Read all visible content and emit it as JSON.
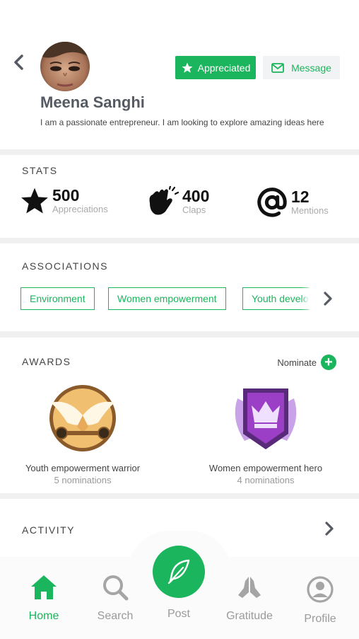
{
  "colors": {
    "accent": "#1ab55c",
    "background": "#f0f0f0"
  },
  "profile": {
    "name": "Meena Sanghi",
    "bio": "I am a passionate entrepreneur. I am looking to explore amazing ideas here",
    "appreciated_label": "Appreciated",
    "message_label": "Message"
  },
  "stats": {
    "title": "STATS",
    "items": [
      {
        "icon": "star-icon",
        "value": "500",
        "label": "Appreciations"
      },
      {
        "icon": "clap-icon",
        "value": "400",
        "label": "Claps"
      },
      {
        "icon": "at-icon",
        "value": "12",
        "label": "Mentions"
      }
    ]
  },
  "associations": {
    "title": "ASSOCIATIONS",
    "chips": [
      "Environment",
      "Women empowerment",
      "Youth development"
    ]
  },
  "awards": {
    "title": "AWARDS",
    "nominate_label": "Nominate",
    "items": [
      {
        "icon": "winged-medal-icon",
        "name": "Youth empowerment warrior",
        "nominations": "5 nominations"
      },
      {
        "icon": "crown-shield-icon",
        "name": "Women empowerment hero",
        "nominations": "4 nominations"
      }
    ]
  },
  "activity": {
    "title": "ACTIVITY"
  },
  "nav": {
    "items": [
      {
        "icon": "home-icon",
        "label": "Home",
        "active": true
      },
      {
        "icon": "search-icon",
        "label": "Search",
        "active": false
      },
      {
        "icon": "feather-icon",
        "label": "Post",
        "active": false
      },
      {
        "icon": "praying-hands-icon",
        "label": "Gratitude",
        "active": false
      },
      {
        "icon": "profile-icon",
        "label": "Profile",
        "active": false
      }
    ]
  }
}
